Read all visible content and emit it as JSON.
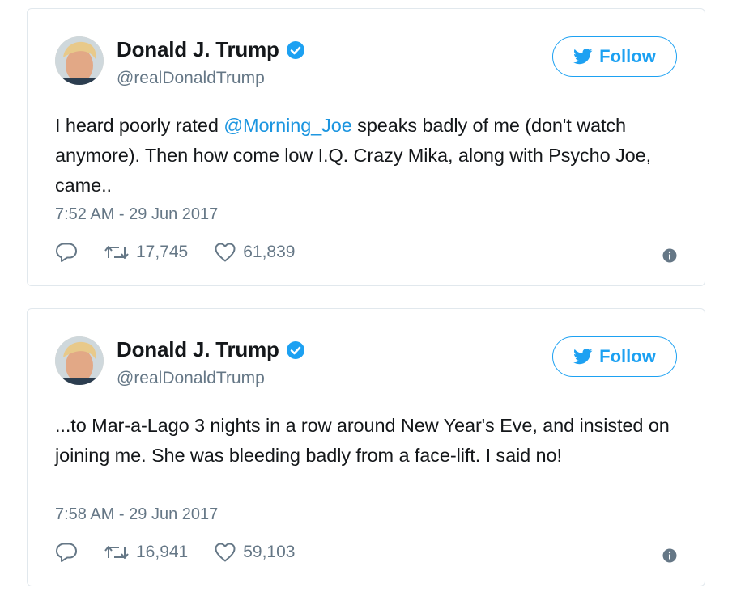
{
  "tweets": [
    {
      "author": {
        "display_name": "Donald J. Trump",
        "handle": "@realDonaldTrump",
        "verified": true
      },
      "follow_label": "Follow",
      "text_parts": {
        "before": "I heard poorly rated ",
        "mention": "@Morning_Joe",
        "after": " speaks badly of me (don't watch anymore). Then how come low I.Q. Crazy Mika, along with Psycho Joe, came.."
      },
      "timestamp": "7:52 AM - 29 Jun 2017",
      "retweets": "17,745",
      "likes": "61,839"
    },
    {
      "author": {
        "display_name": "Donald J. Trump",
        "handle": "@realDonaldTrump",
        "verified": true
      },
      "follow_label": "Follow",
      "text_parts": {
        "before": "...to Mar-a-Lago 3 nights in a row around New Year's Eve, and insisted on joining me. She was bleeding badly from a face-lift. I said no!"
      },
      "timestamp": "7:58 AM - 29 Jun 2017",
      "retweets": "16,941",
      "likes": "59,103"
    }
  ],
  "icons": {
    "verified": "verified-badge-icon",
    "follow": "twitter-bird-icon",
    "reply": "reply-icon",
    "retweet": "retweet-icon",
    "like": "heart-icon",
    "info": "info-icon"
  },
  "colors": {
    "accent": "#1da1f2",
    "mention": "#1b95e0",
    "muted": "#657786",
    "text": "#14171a",
    "border": "#e1e8ed"
  }
}
